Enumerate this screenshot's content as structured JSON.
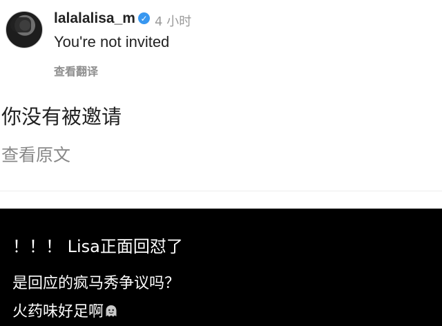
{
  "post": {
    "username": "lalalalisa_m",
    "verified_icon": "verified-check-icon",
    "time": "4 小时",
    "comment": "You're not invited",
    "see_translation": "查看翻译"
  },
  "translation": {
    "text": "你没有被邀请",
    "see_original": "查看原文"
  },
  "caption": {
    "line1": "！！！ Lisa正面回怼了",
    "line2": "是回应的疯马秀争议吗？",
    "line3": "火药味好足啊",
    "emoji_icon": "ghost-face-icon"
  },
  "colors": {
    "verified": "#3897f0",
    "caption_bg": "#000000",
    "muted_text": "#8e8e8e"
  }
}
